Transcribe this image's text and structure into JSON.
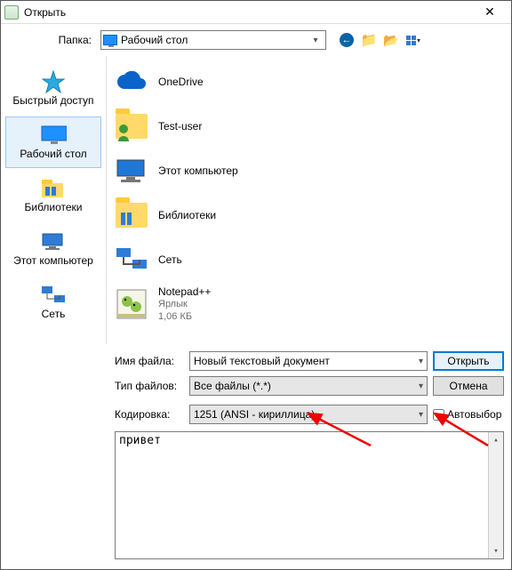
{
  "title": "Открыть",
  "folder_label": "Папка:",
  "folder_value": "Рабочий стол",
  "places": [
    {
      "id": "quick",
      "label": "Быстрый доступ",
      "icon": "star"
    },
    {
      "id": "desktop",
      "label": "Рабочий стол",
      "icon": "monitor",
      "selected": true
    },
    {
      "id": "libs",
      "label": "Библиотеки",
      "icon": "libraries"
    },
    {
      "id": "pc",
      "label": "Этот компьютер",
      "icon": "pc"
    },
    {
      "id": "net",
      "label": "Сеть",
      "icon": "network"
    }
  ],
  "items": [
    {
      "name": "OneDrive",
      "icon": "cloud"
    },
    {
      "name": "Test-user",
      "icon": "userfolder"
    },
    {
      "name": "Этот компьютер",
      "icon": "pc-big"
    },
    {
      "name": "Библиотеки",
      "icon": "lib-big"
    },
    {
      "name": "Сеть",
      "icon": "net-big"
    },
    {
      "name": "Notepad++",
      "icon": "npp",
      "sub1": "Ярлык",
      "sub2": "1,06 КБ"
    }
  ],
  "filename_label": "Имя файла:",
  "filename_value": "Новый текстовый документ",
  "filetype_label": "Тип файлов:",
  "filetype_value": "Все файлы (*.*)",
  "encoding_label": "Кодировка:",
  "encoding_value": "1251  (ANSI - кириллица)",
  "auto_label": "Автовыбор",
  "open_btn": "Открыть",
  "cancel_btn": "Отмена",
  "preview_text": "привет",
  "toolbar_icons": [
    "back",
    "up",
    "new",
    "views"
  ]
}
